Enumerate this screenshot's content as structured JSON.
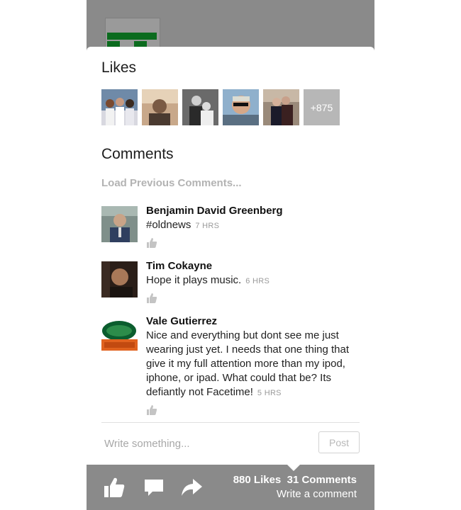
{
  "likes": {
    "title": "Likes",
    "more_count": "+875"
  },
  "comments": {
    "title": "Comments",
    "load_previous": "Load Previous Comments...",
    "items": [
      {
        "author": "Benjamin David Greenberg",
        "text": "#oldnews",
        "time": "7 HRS"
      },
      {
        "author": "Tim Cokayne",
        "text": "Hope it plays music.",
        "time": "6 HRS"
      },
      {
        "author": "Vale Gutierrez",
        "text": "Nice and everything but dont see me just wearing just yet. I needs that one thing that give it my full attention more than my ipod, iphone, or ipad. What could that be? Its defiantly not Facetime!",
        "time": "5 HRS"
      }
    ]
  },
  "compose": {
    "placeholder": "Write something...",
    "post_label": "Post"
  },
  "toolbar": {
    "likes_count": "880 Likes",
    "comments_count": "31 Comments",
    "write_comment": "Write a comment"
  },
  "colors": {
    "overlay": "#8a8a8a",
    "accent_green": "#0b6b1e",
    "muted_text": "#b3b3b3"
  },
  "icons": [
    "thumbs-up-icon",
    "comment-bubble-icon",
    "share-arrow-icon",
    "small-like-icon"
  ]
}
